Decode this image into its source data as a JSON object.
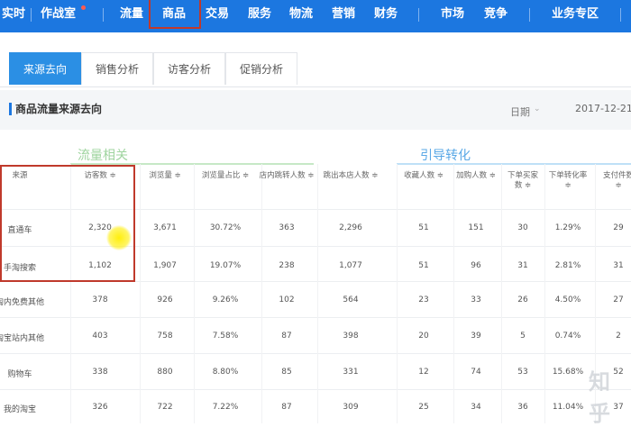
{
  "nav": {
    "items": [
      "实时",
      "作战室",
      "流量",
      "商品",
      "交易",
      "服务",
      "物流",
      "营销",
      "财务",
      "市场",
      "竞争",
      "业务专区"
    ],
    "selected": "商品"
  },
  "tabs": [
    {
      "label": "来源去向",
      "active": true
    },
    {
      "label": "销售分析",
      "active": false
    },
    {
      "label": "访客分析",
      "active": false
    },
    {
      "label": "促销分析",
      "active": false
    }
  ],
  "section": {
    "title": "商品流量来源去向",
    "date_label": "日期",
    "date_value": "2017-12-21"
  },
  "groups": {
    "traffic": "流量相关",
    "conversion": "引导转化"
  },
  "table": {
    "headers": [
      "来源",
      "访客数 ≑",
      "浏览量 ≑",
      "浏览量占比 ≑",
      "店内跳转人数 ≑",
      "跳出本店人数 ≑",
      "收藏人数 ≑",
      "加购人数 ≑",
      "下单买家数 ≑",
      "下单转化率 ≑",
      "支付件数 ≑"
    ],
    "rows": [
      [
        "直通车",
        "2,320",
        "3,671",
        "30.72%",
        "363",
        "2,296",
        "51",
        "151",
        "30",
        "1.29%",
        "29"
      ],
      [
        "手淘搜索",
        "1,102",
        "1,907",
        "19.07%",
        "238",
        "1,077",
        "51",
        "96",
        "31",
        "2.81%",
        "31"
      ],
      [
        "淘内免费其他",
        "378",
        "926",
        "9.26%",
        "102",
        "564",
        "23",
        "33",
        "26",
        "4.50%",
        "27"
      ],
      [
        "淘宝站内其他",
        "403",
        "758",
        "7.58%",
        "87",
        "398",
        "20",
        "39",
        "5",
        "0.74%",
        "2"
      ],
      [
        "购物车",
        "338",
        "880",
        "8.80%",
        "85",
        "331",
        "12",
        "74",
        "53",
        "15.68%",
        "52"
      ],
      [
        "我的淘宝",
        "326",
        "722",
        "7.22%",
        "87",
        "309",
        "25",
        "34",
        "36",
        "11.04%",
        "37"
      ]
    ]
  },
  "watermark": "知乎",
  "colors": {
    "nav": "#1c77e0",
    "tab_active": "#2b8fe4",
    "highlight": "#c0392b"
  }
}
